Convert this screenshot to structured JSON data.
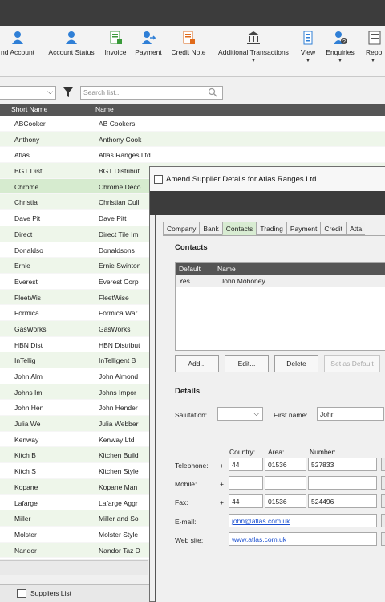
{
  "ribbon": {
    "items": [
      {
        "label": "nd Account",
        "icon": "person-add-icon"
      },
      {
        "label": "Account Status",
        "icon": "person-icon"
      },
      {
        "label": "Invoice",
        "icon": "invoice-icon"
      },
      {
        "label": "Payment",
        "icon": "payment-icon"
      },
      {
        "label": "Credit Note",
        "icon": "credit-note-icon"
      },
      {
        "label": "Additional Transactions",
        "icon": "bank-icon"
      },
      {
        "label": "View",
        "icon": "view-icon"
      },
      {
        "label": "Enquiries",
        "icon": "enquiries-icon"
      },
      {
        "label": "Repo",
        "icon": "reports-icon"
      }
    ]
  },
  "filter": {
    "search_placeholder": "Search list..."
  },
  "grid": {
    "headers": [
      "Short Name",
      "Name"
    ],
    "rows": [
      {
        "short": "ABCooker",
        "name": "AB Cookers"
      },
      {
        "short": "Anthony",
        "name": "Anthony Cook"
      },
      {
        "short": "Atlas",
        "name": "Atlas Ranges Ltd"
      },
      {
        "short": "BGT Dist",
        "name": "BGT Distribut"
      },
      {
        "short": "Chrome",
        "name": "Chrome Deco"
      },
      {
        "short": "Christia",
        "name": "Christian Cull"
      },
      {
        "short": "Dave Pit",
        "name": "Dave Pitt"
      },
      {
        "short": "Direct",
        "name": "Direct Tile Im"
      },
      {
        "short": "Donaldso",
        "name": "Donaldsons"
      },
      {
        "short": "Ernie",
        "name": "Ernie Swinton"
      },
      {
        "short": "Everest",
        "name": "Everest Corp"
      },
      {
        "short": "FleetWis",
        "name": "FleetWise"
      },
      {
        "short": "Formica",
        "name": "Formica War"
      },
      {
        "short": "GasWorks",
        "name": "GasWorks"
      },
      {
        "short": "HBN Dist",
        "name": "HBN Distribut"
      },
      {
        "short": "InTellig",
        "name": "InTelligent B"
      },
      {
        "short": "John Alm",
        "name": "John Almond"
      },
      {
        "short": "Johns Im",
        "name": "Johns Impor"
      },
      {
        "short": "John Hen",
        "name": "John Hender"
      },
      {
        "short": "Julia We",
        "name": "Julia Webber"
      },
      {
        "short": "Kenway",
        "name": "Kenway Ltd"
      },
      {
        "short": "Kitch B",
        "name": "Kitchen Build"
      },
      {
        "short": "Kitch S",
        "name": "Kitchen Style"
      },
      {
        "short": "Kopane",
        "name": "Kopane Man"
      },
      {
        "short": "Lafarge",
        "name": "Lafarge Aggr"
      },
      {
        "short": "Miller",
        "name": "Miller and So"
      },
      {
        "short": "Molster",
        "name": "Molster Style"
      },
      {
        "short": "Nandor",
        "name": "Nandor Taz D"
      }
    ]
  },
  "taskbar": {
    "item": "Suppliers List"
  },
  "dialog": {
    "title": "Amend Supplier Details for Atlas Ranges Ltd",
    "tabs": [
      "Company",
      "Bank",
      "Contacts",
      "Trading",
      "Payment",
      "Credit",
      "Atta"
    ],
    "active_tab": "Contacts",
    "contacts_heading": "Contacts",
    "contacts_headers": [
      "Default",
      "Name"
    ],
    "contacts_rows": [
      {
        "default": "Yes",
        "name": "John Mohoney"
      }
    ],
    "buttons": {
      "add": "Add...",
      "edit": "Edit...",
      "delete": "Delete",
      "set_default": "Set as Default"
    },
    "details_heading": "Details",
    "salutation_label": "Salutation:",
    "salutation_value": "",
    "first_name_label": "First name:",
    "first_name_value": "John",
    "col_country": "Country:",
    "col_area": "Area:",
    "col_number": "Number:",
    "phones": [
      {
        "label": "Telephone:",
        "plus": "+",
        "country": "44",
        "area": "01536",
        "number": "527833"
      },
      {
        "label": "Mobile:",
        "plus": "+",
        "country": "",
        "area": "",
        "number": ""
      },
      {
        "label": "Fax:",
        "plus": "+",
        "country": "44",
        "area": "01536",
        "number": "524496"
      }
    ],
    "email_label": "E-mail:",
    "email_value": "john@atlas.com.uk",
    "web_label": "Web site:",
    "web_value": "www.atlas.com.uk"
  },
  "colors": {
    "header_bg": "#555555",
    "alt_row": "#eef6ea",
    "selected_row": "#d6ebcf",
    "active_tab": "#d8ecd2",
    "link": "#1a4fd0"
  }
}
